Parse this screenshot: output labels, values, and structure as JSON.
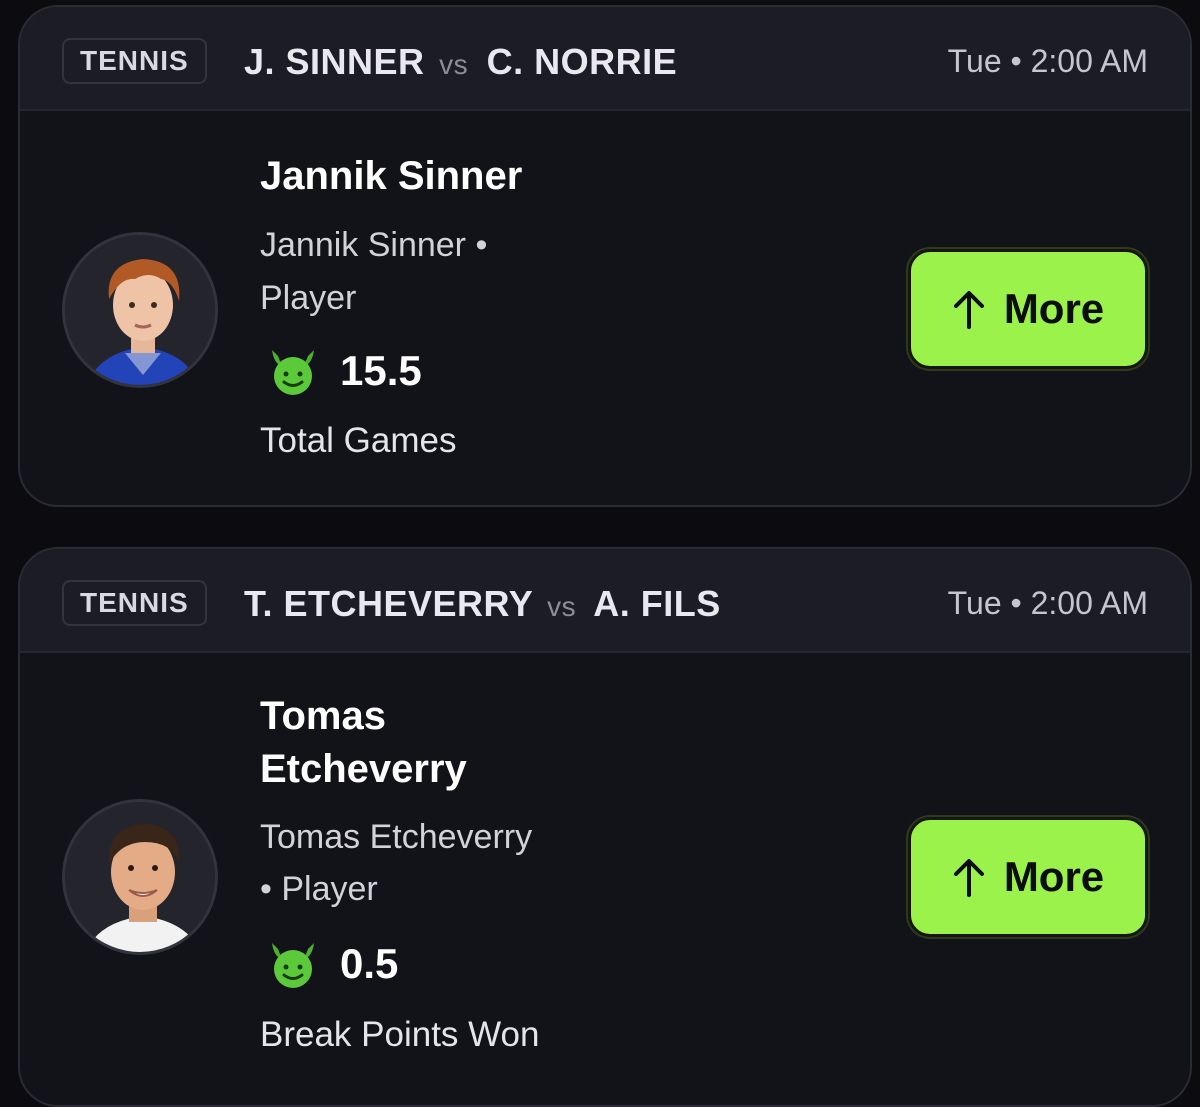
{
  "cards": [
    {
      "sport": "TENNIS",
      "player_a": "J. SINNER",
      "vs": "vs",
      "player_b": "C. NORRIE",
      "time": "Tue • 2:00 AM",
      "player_name": "Jannik Sinner",
      "subtitle_line1": "Jannik Sinner •",
      "subtitle_line2": "Player",
      "line_value": "15.5",
      "stat": "Total Games",
      "button_label": "More"
    },
    {
      "sport": "TENNIS",
      "player_a": "T. ETCHEVERRY",
      "vs": "vs",
      "player_b": "A. FILS",
      "time": "Tue • 2:00 AM",
      "player_name_line1": "Tomas",
      "player_name_line2": "Etcheverry",
      "subtitle_line1": "Tomas Etcheverry",
      "subtitle_line2": "• Player",
      "line_value": "0.5",
      "stat": "Break Points Won",
      "button_label": "More"
    }
  ],
  "icons": {
    "line_icon": "smiling-devil-icon",
    "button_icon": "arrow-up-icon"
  },
  "colors": {
    "accent_green": "#9af24b",
    "card_bg": "#121219",
    "header_bg": "#1c1c24"
  }
}
